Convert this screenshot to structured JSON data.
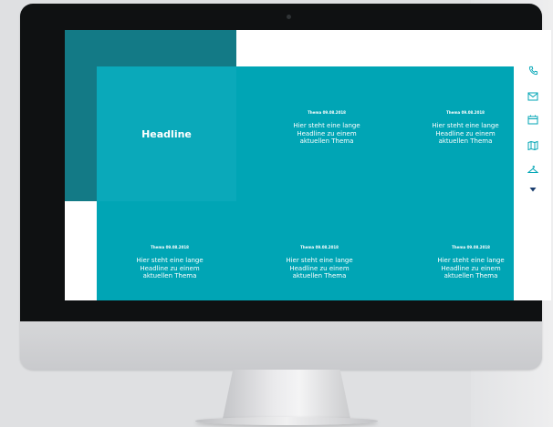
{
  "screen": {
    "featured": {
      "headline": "Headline"
    },
    "articles": [
      {
        "date": "Thema 09.08.2018",
        "title": "Hier steht eine lange Headline zu einem aktuellen Thema"
      },
      {
        "date": "Thema 09.08.2018",
        "title": "Hier steht eine lange Headline zu einem aktuellen Thema"
      },
      {
        "date": "Thema 09.08.2018",
        "title": "Hier steht eine lange Headline zu einem aktuellen Thema"
      },
      {
        "date": "Thema 09.08.2018",
        "title": "Hier steht eine lange Headline zu einem aktuellen Thema"
      },
      {
        "date": "Thema 09.08.2018",
        "title": "Hier steht eine lange Headline zu einem aktuellen Thema"
      }
    ],
    "side_icons": [
      "phone-icon",
      "mail-icon",
      "calendar-icon",
      "map-icon",
      "hanger-icon",
      "arrow-down-icon"
    ]
  },
  "colors": {
    "teal": "#00a5b5",
    "dark_teal": "#137a86",
    "headline_box": "#0aa9ba",
    "bezel": "#0f1112"
  }
}
